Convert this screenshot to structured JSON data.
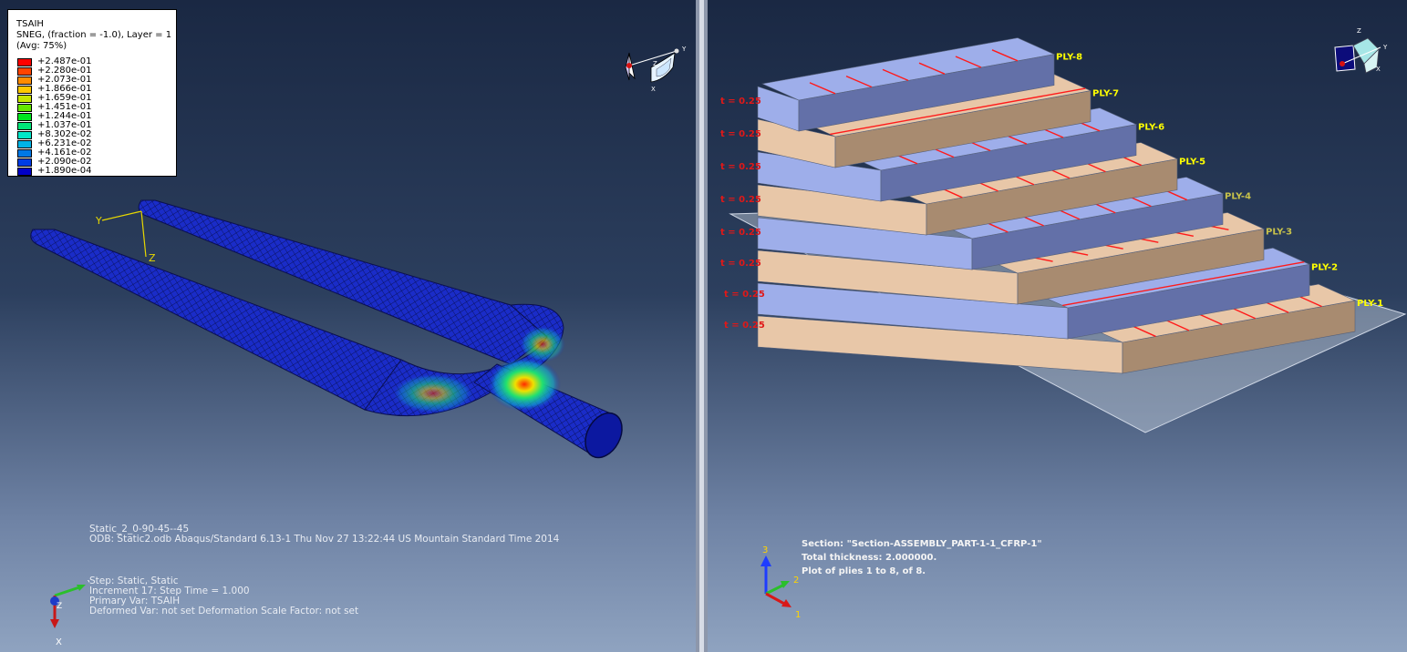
{
  "left_viewport": {
    "legend": {
      "title": "TSAIH",
      "subtitle": "SNEG, (fraction = -1.0), Layer = 1",
      "averaging": "(Avg: 75%)",
      "entries": [
        {
          "value": "+2.487e-01",
          "color": "#ff0000"
        },
        {
          "value": "+2.280e-01",
          "color": "#ff4400"
        },
        {
          "value": "+2.073e-01",
          "color": "#ff8c00"
        },
        {
          "value": "+1.866e-01",
          "color": "#ffc800"
        },
        {
          "value": "+1.659e-01",
          "color": "#c8e600"
        },
        {
          "value": "+1.451e-01",
          "color": "#64e600"
        },
        {
          "value": "+1.244e-01",
          "color": "#00e61e"
        },
        {
          "value": "+1.037e-01",
          "color": "#00e678"
        },
        {
          "value": "+8.302e-02",
          "color": "#00e6c8"
        },
        {
          "value": "+6.231e-02",
          "color": "#00b4e6"
        },
        {
          "value": "+4.161e-02",
          "color": "#0078e6"
        },
        {
          "value": "+2.090e-02",
          "color": "#003ce6"
        },
        {
          "value": "+1.890e-04",
          "color": "#0000c8"
        }
      ]
    },
    "model_axes": {
      "y": "Y",
      "z": "Z"
    },
    "triad": {
      "x": "X",
      "y": "Y",
      "z": "Z"
    },
    "info_lines": [
      "Static_2_0-90-45--45",
      "ODB: Static2.odb    Abaqus/Standard 6.13-1    Thu Nov 27 13:22:44 US Mountain Standard Time 2014"
    ],
    "step_lines": [
      "Step: Static, Static",
      "Increment     17: Step Time =     1.000",
      "Primary Var: TSAIH",
      "Deformed Var: not set   Deformation Scale Factor: not set"
    ]
  },
  "right_viewport": {
    "ply_labels": [
      "PLY-8",
      "PLY-7",
      "PLY-6",
      "PLY-5",
      "PLY-4",
      "PLY-3",
      "PLY-2",
      "PLY-1"
    ],
    "thickness_label": "t = 0.25",
    "section_lines": [
      "Section: \"Section-ASSEMBLY_PART-1-1_CFRP-1\"",
      "Total thickness: 2.000000.",
      "Plot of plies 1 to 8, of 8."
    ],
    "triad": {
      "one": "1",
      "two": "2",
      "three": "3"
    },
    "ply_colors": {
      "blue": "#9eaeea",
      "tan": "#e8c7a8",
      "fiber": "#ff1a1a"
    }
  },
  "mini_view_triad": {
    "x": "X",
    "y": "Y",
    "z": "Z"
  }
}
